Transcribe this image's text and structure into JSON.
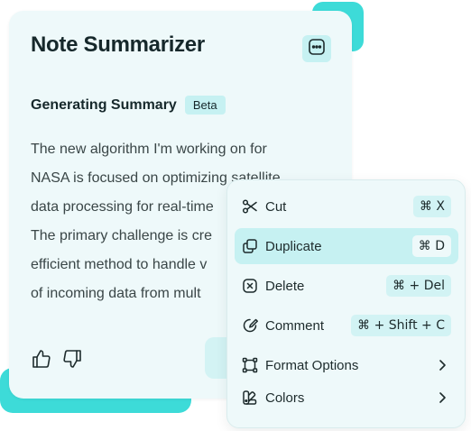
{
  "card": {
    "title": "Note Summarizer",
    "more_icon": "more-horizontal-icon",
    "subtitle": "Generating Summary",
    "badge": "Beta",
    "lines": [
      "The new algorithm I'm working on for",
      "NASA is focused on optimizing satellite",
      "data processing for real-time",
      "The primary challenge is cre",
      "efficient method to handle v",
      "of incoming data from mult"
    ],
    "feedback_icons": [
      "thumbs-up-icon",
      "thumbs-down-icon"
    ]
  },
  "menu": {
    "items": [
      {
        "label": "Cut",
        "icon": "scissors-icon",
        "shortcut": "⌘ X"
      },
      {
        "label": "Duplicate",
        "icon": "copy-icon",
        "shortcut": "⌘ D",
        "active": true
      },
      {
        "label": "Delete",
        "icon": "x-circle-icon",
        "shortcut": "⌘ + Del"
      },
      {
        "label": "Comment",
        "icon": "comment-edit-icon",
        "shortcut": "⌘ + Shift + C"
      },
      {
        "label": "Format Options",
        "icon": "format-options-icon",
        "submenu": true
      },
      {
        "label": "Colors",
        "icon": "palette-icon",
        "submenu": true
      }
    ]
  },
  "colors": {
    "accent": "#3ddbd8",
    "card_bg": "#eef9fa",
    "highlight": "#c6f1f2"
  }
}
